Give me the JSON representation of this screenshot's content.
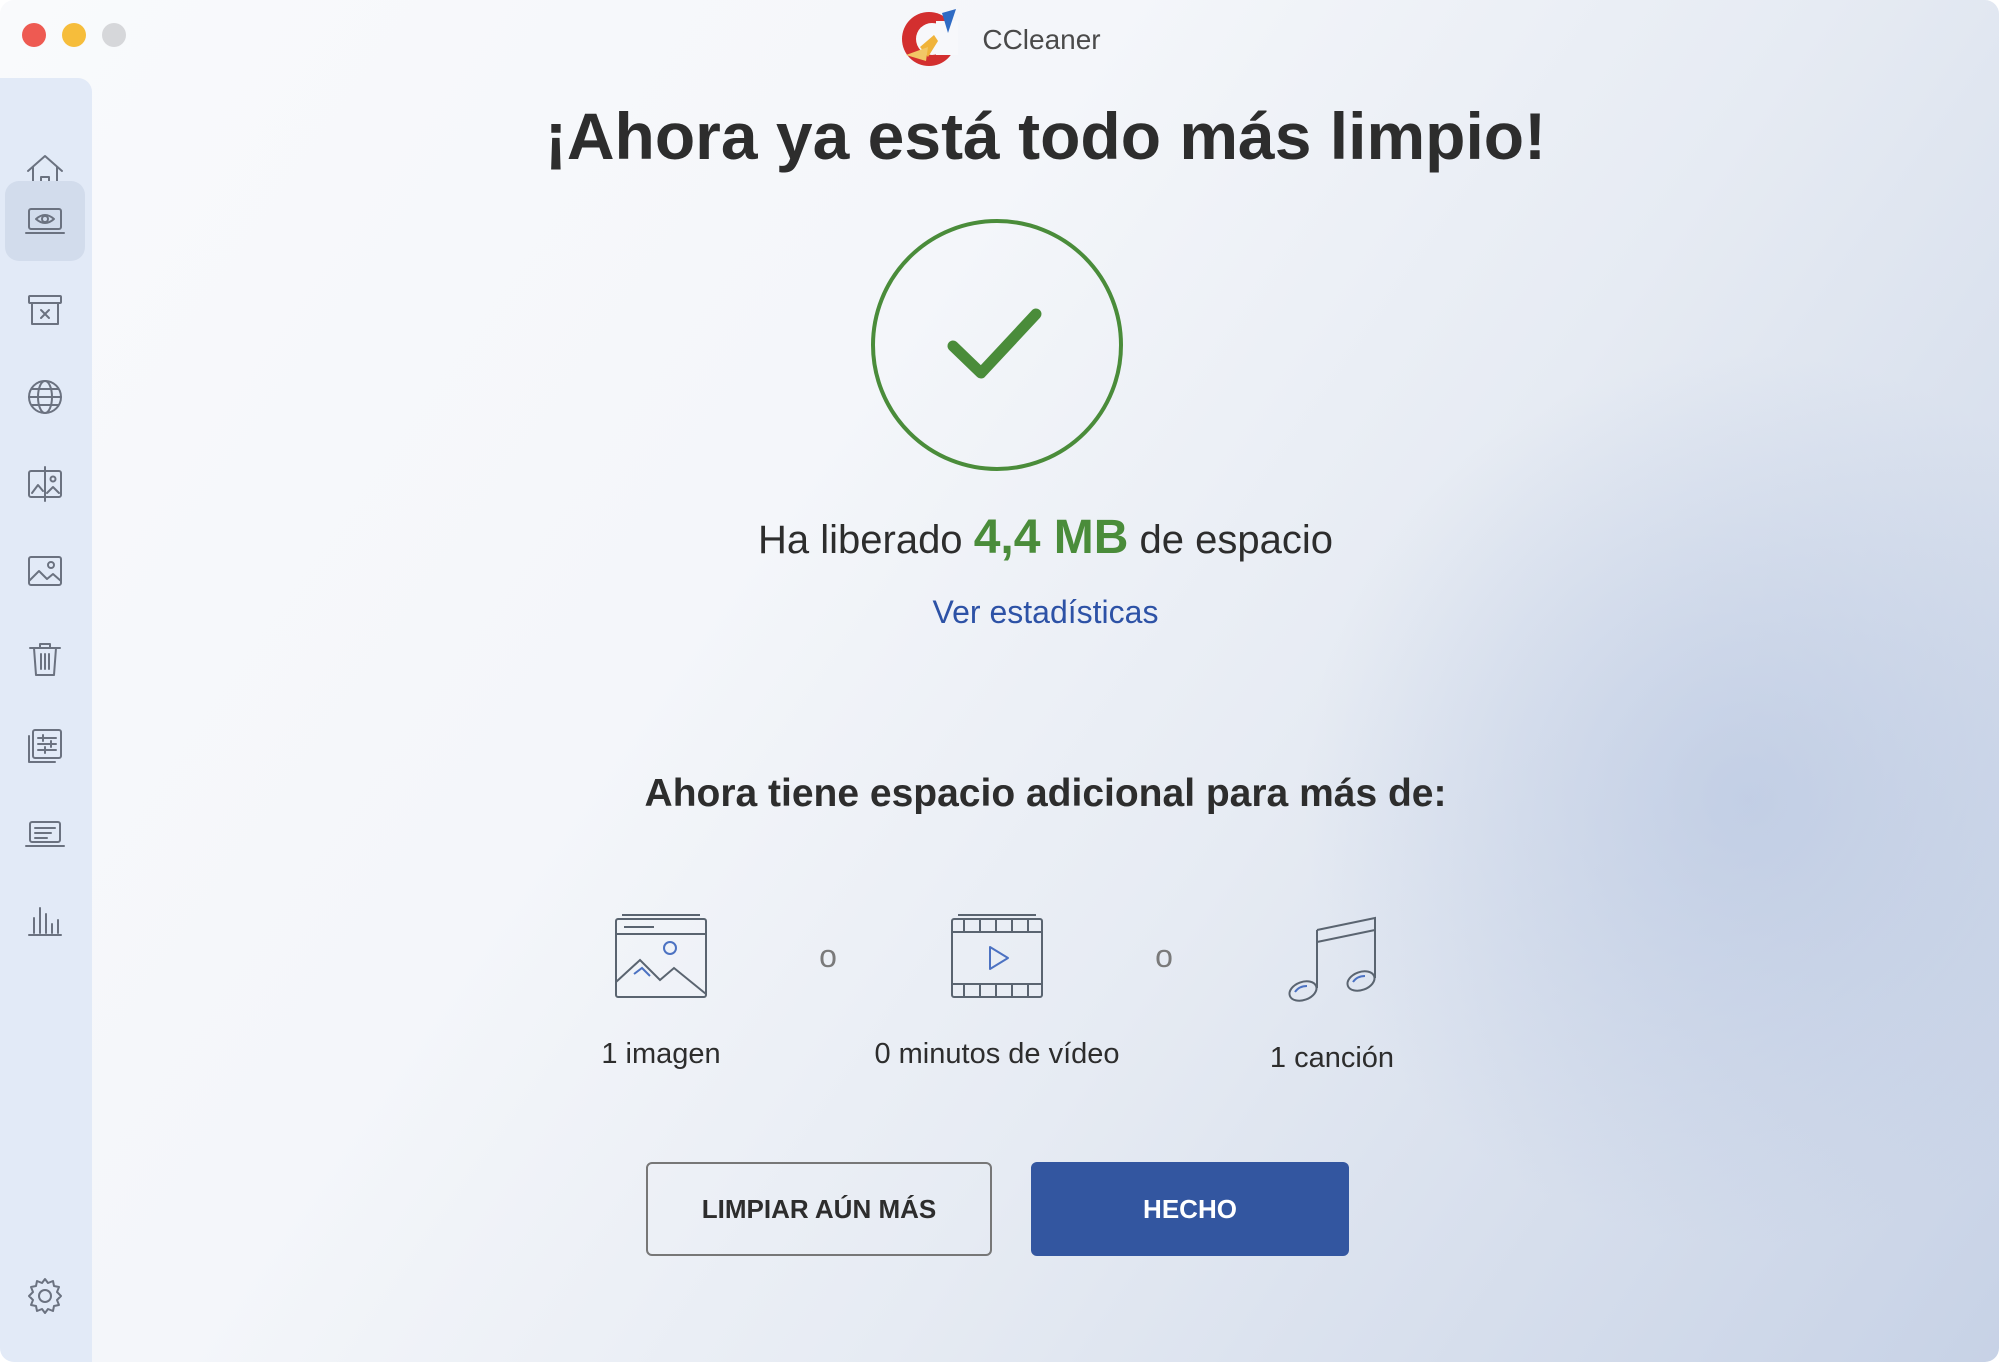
{
  "window": {
    "title": "CCleaner"
  },
  "sidebar": {
    "items": [
      {
        "icon": "home-icon"
      },
      {
        "icon": "laptop-eye-icon",
        "active": true
      },
      {
        "icon": "archive-box-icon"
      },
      {
        "icon": "globe-icon"
      },
      {
        "icon": "compare-images-icon"
      },
      {
        "icon": "image-icon"
      },
      {
        "icon": "trash-icon"
      },
      {
        "icon": "list-settings-icon"
      },
      {
        "icon": "laptop-icon"
      },
      {
        "icon": "bar-chart-icon"
      }
    ],
    "settings_icon": "gear-icon"
  },
  "main": {
    "title": "¡Ahora ya está todo más limpio!",
    "freed_prefix": "Ha liberado",
    "freed_amount": "4,4 MB",
    "freed_suffix": "de espacio",
    "stats_link": "Ver estadísticas",
    "subtitle": "Ahora tiene espacio adicional para más de:",
    "media": [
      {
        "icon": "image-icon",
        "label": "1 imagen"
      },
      {
        "icon": "video-icon",
        "label": "0 minutos de vídeo"
      },
      {
        "icon": "music-note-icon",
        "label": "1 canción"
      }
    ],
    "separator": "o"
  },
  "buttons": {
    "clean_more": "LIMPIAR AÚN MÁS",
    "done": "HECHO"
  },
  "colors": {
    "accent": "#3356a0",
    "success": "#4a8c3a",
    "link": "#2d52a6"
  }
}
